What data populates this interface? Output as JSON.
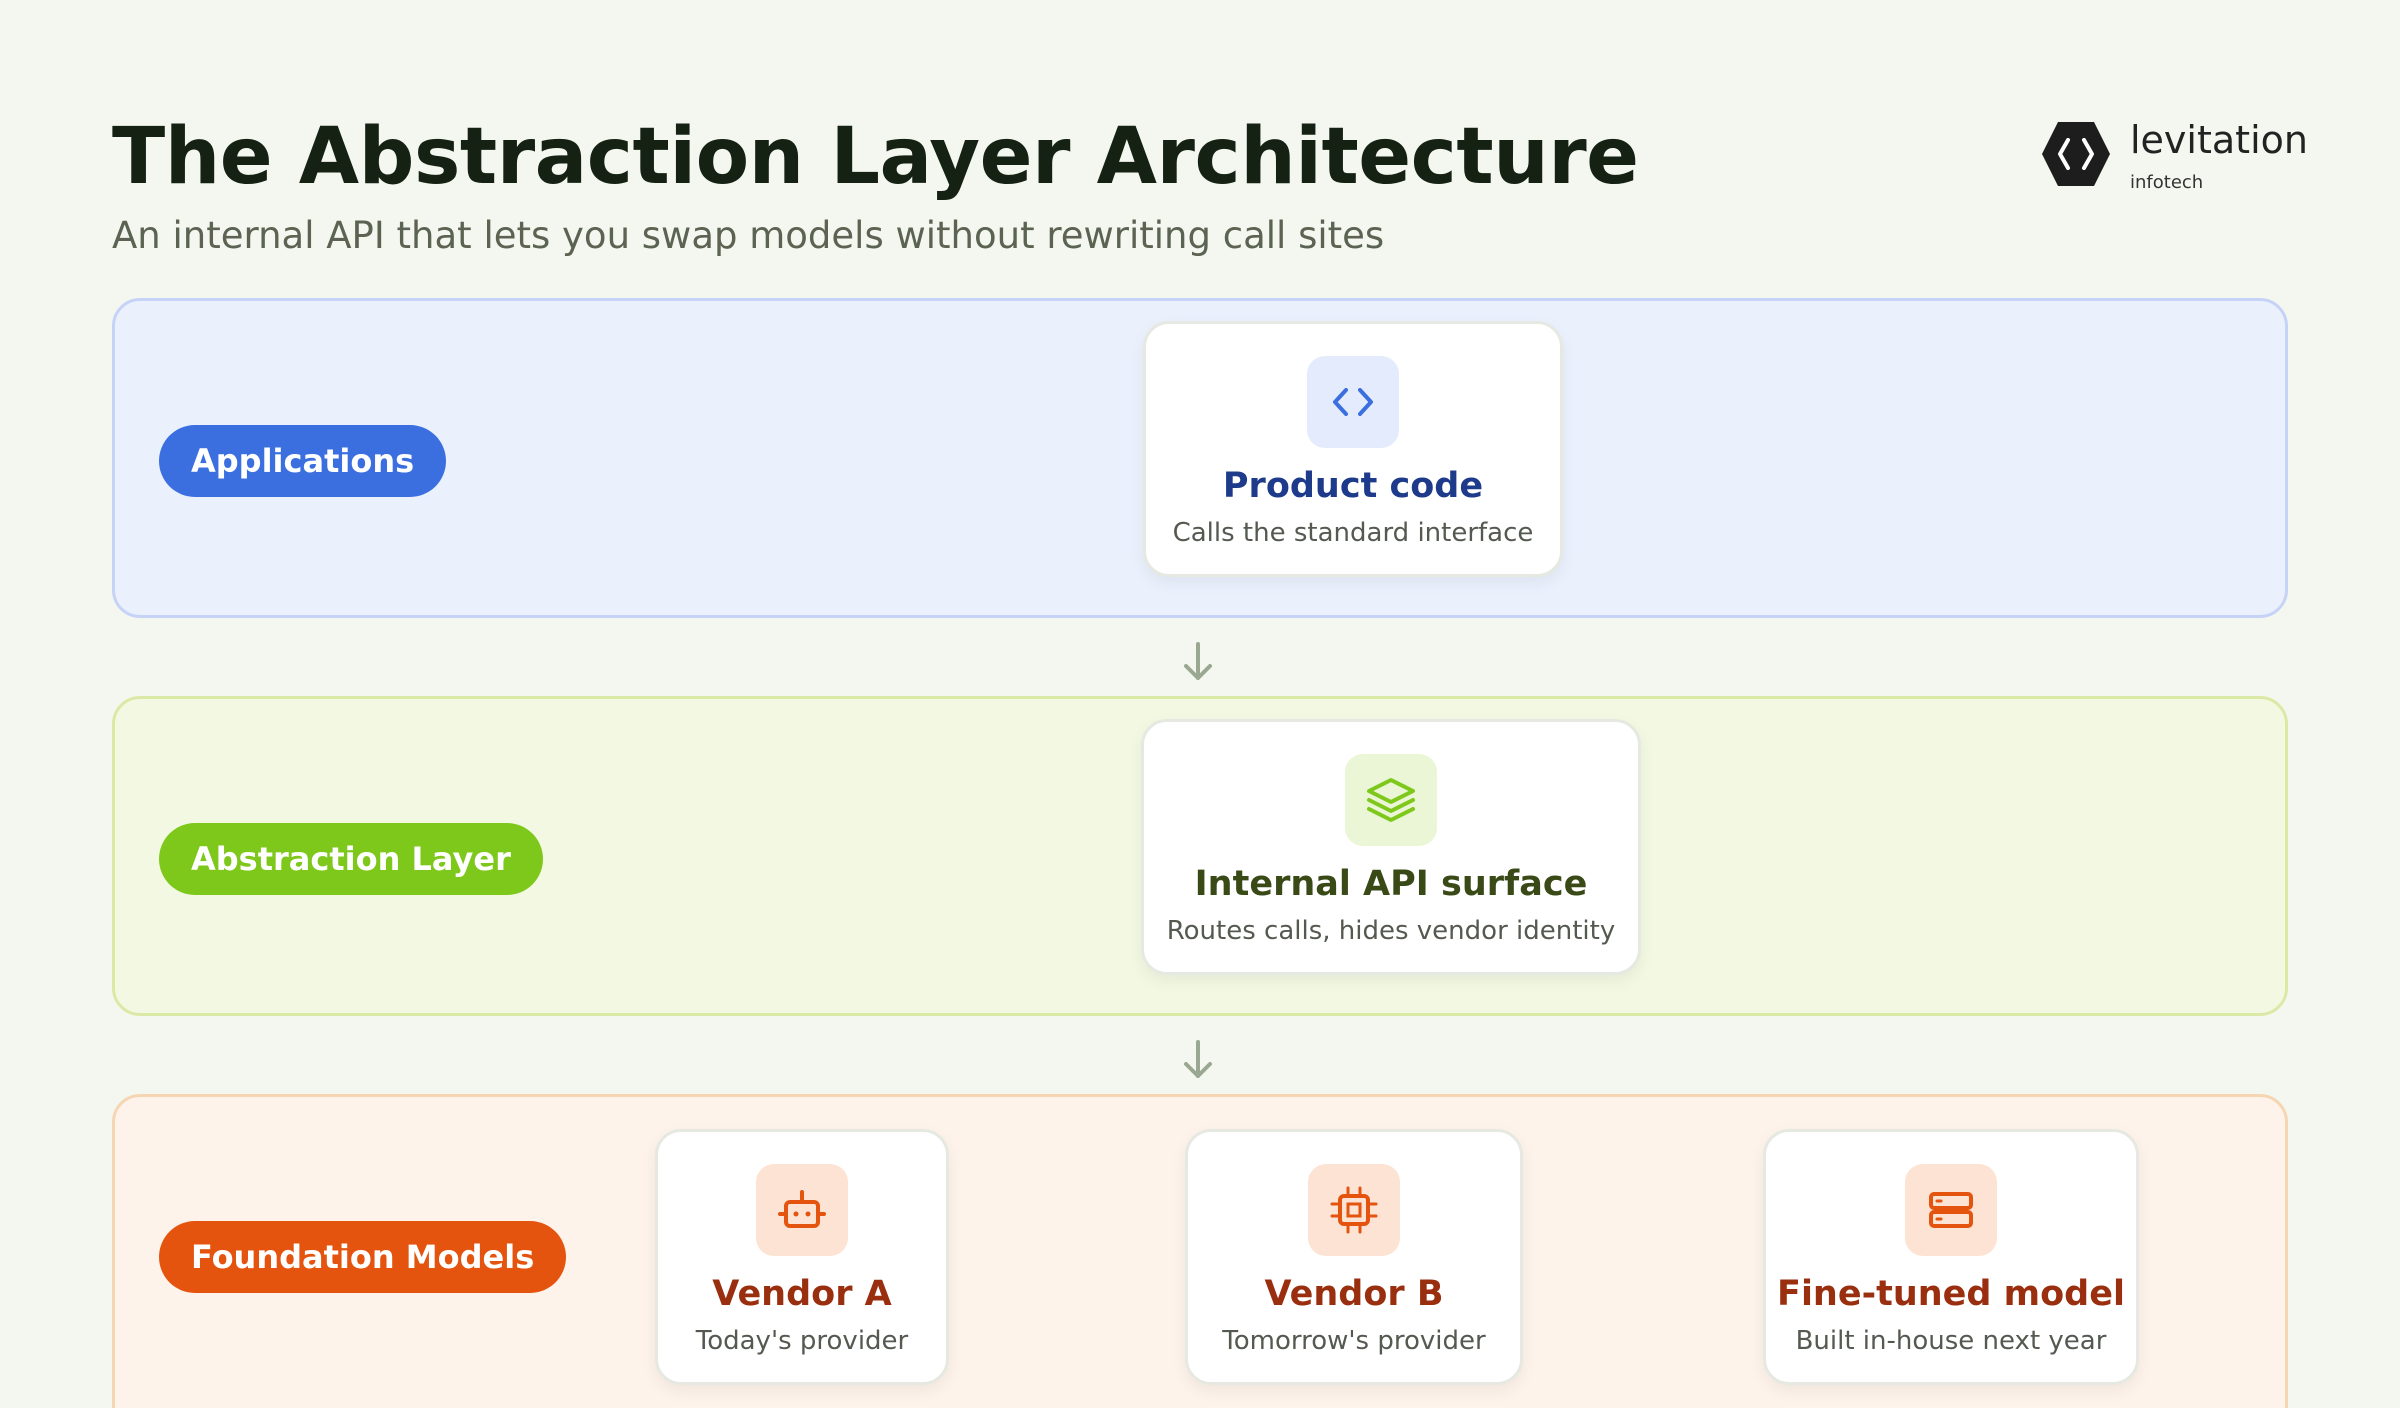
{
  "header": {
    "title": "The Abstraction Layer Architecture",
    "subtitle": "An internal API that lets you swap models without rewriting call sites"
  },
  "logo": {
    "name": "levitation",
    "tagline": "infotech"
  },
  "layers": {
    "applications": {
      "label": "Applications",
      "card": {
        "title": "Product code",
        "subtitle": "Calls the standard interface",
        "icon": "code-icon"
      }
    },
    "abstraction": {
      "label": "Abstraction Layer",
      "card": {
        "title": "Internal API surface",
        "subtitle": "Routes calls, hides vendor identity",
        "icon": "layers-icon"
      }
    },
    "foundation": {
      "label": "Foundation Models",
      "cards": [
        {
          "title": "Vendor A",
          "subtitle": "Today's provider",
          "icon": "robot-icon"
        },
        {
          "title": "Vendor B",
          "subtitle": "Tomorrow's provider",
          "icon": "chip-icon"
        },
        {
          "title": "Fine-tuned model",
          "subtitle": "Built in-house next year",
          "icon": "server-icon"
        }
      ]
    }
  },
  "colors": {
    "applications_accent": "#3b6fe0",
    "abstraction_accent": "#7ec81c",
    "foundation_accent": "#e4540f",
    "applications_title": "#1e3a8a",
    "abstraction_title": "#3a4a17",
    "foundation_title": "#9a2f10"
  }
}
